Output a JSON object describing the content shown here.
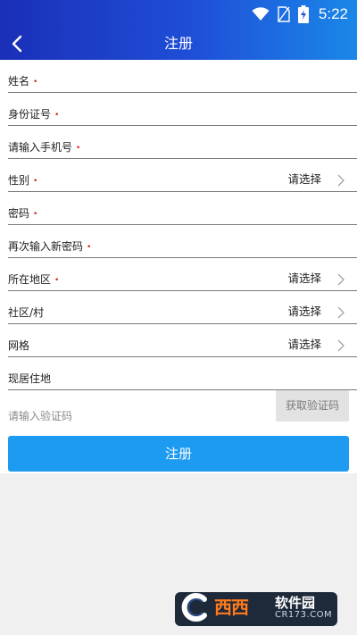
{
  "status_bar": {
    "time": "5:22",
    "icons": [
      "wifi-icon",
      "no-sim-icon",
      "battery-charging-icon"
    ]
  },
  "app_bar": {
    "title": "注册",
    "back_icon": "chevron-left-icon"
  },
  "form": {
    "fields": [
      {
        "label": "姓名",
        "required": true,
        "value": ""
      },
      {
        "label": "身份证号",
        "required": true,
        "value": ""
      },
      {
        "label": "请输入手机号",
        "required": true,
        "value": ""
      },
      {
        "label": "性别",
        "required": true,
        "value": "请选择",
        "has_chevron": true
      },
      {
        "label": "密码",
        "required": true,
        "value": ""
      },
      {
        "label": "再次输入新密码",
        "required": true,
        "value": ""
      },
      {
        "label": "所在地区",
        "required": true,
        "value": "请选择",
        "has_chevron": true
      },
      {
        "label": "社区/村",
        "required": false,
        "value": "请选择",
        "has_chevron": true
      },
      {
        "label": "网格",
        "required": false,
        "value": "请选择",
        "has_chevron": true
      },
      {
        "label": "现居住地",
        "required": false,
        "value": ""
      }
    ],
    "required_mark": "•",
    "verification_code": {
      "placeholder": "请输入验证码",
      "button_label": "获取验证码"
    },
    "submit_label": "注册"
  },
  "watermark": {
    "main": "西西",
    "sub": "软件园",
    "url": "CR173.COM"
  },
  "colors": {
    "header_gradient_start": "#1a2fb8",
    "header_gradient_end": "#1a88e8",
    "submit_button": "#1d9bf0",
    "required_mark": "#e02020",
    "code_button_bg": "#e2e2e2"
  }
}
